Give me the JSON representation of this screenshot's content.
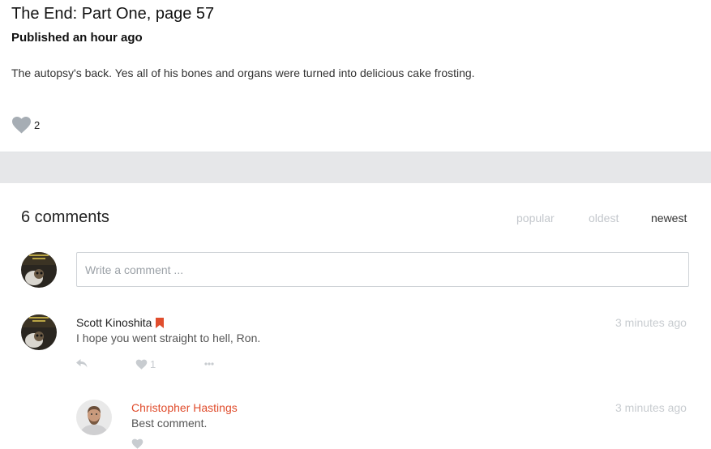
{
  "post": {
    "title": "The End: Part One, page 57",
    "meta": "Published an hour ago",
    "body": "The autopsy's back. Yes all of his bones and organs were turned into delicious cake frosting.",
    "like_count": "2"
  },
  "comments_section": {
    "count_label": "6 comments",
    "sort_options": [
      "popular",
      "oldest",
      "newest"
    ],
    "active_sort": "newest",
    "composer_placeholder": "Write a comment ..."
  },
  "comments": [
    {
      "author": "Scott Kinoshita",
      "text": "I hope you went straight to hell, Ron.",
      "time": "3 minutes ago",
      "like_count": "1",
      "badge_icon": "bookmark-icon"
    }
  ],
  "replies": [
    {
      "author": "Christopher Hastings",
      "text": "Best comment.",
      "time": "3 minutes ago"
    }
  ],
  "colors": {
    "heart": "#a6adb4",
    "action_gray": "#c8ccd0",
    "author_accent": "#e04d2d",
    "band": "#e6e7e9"
  }
}
